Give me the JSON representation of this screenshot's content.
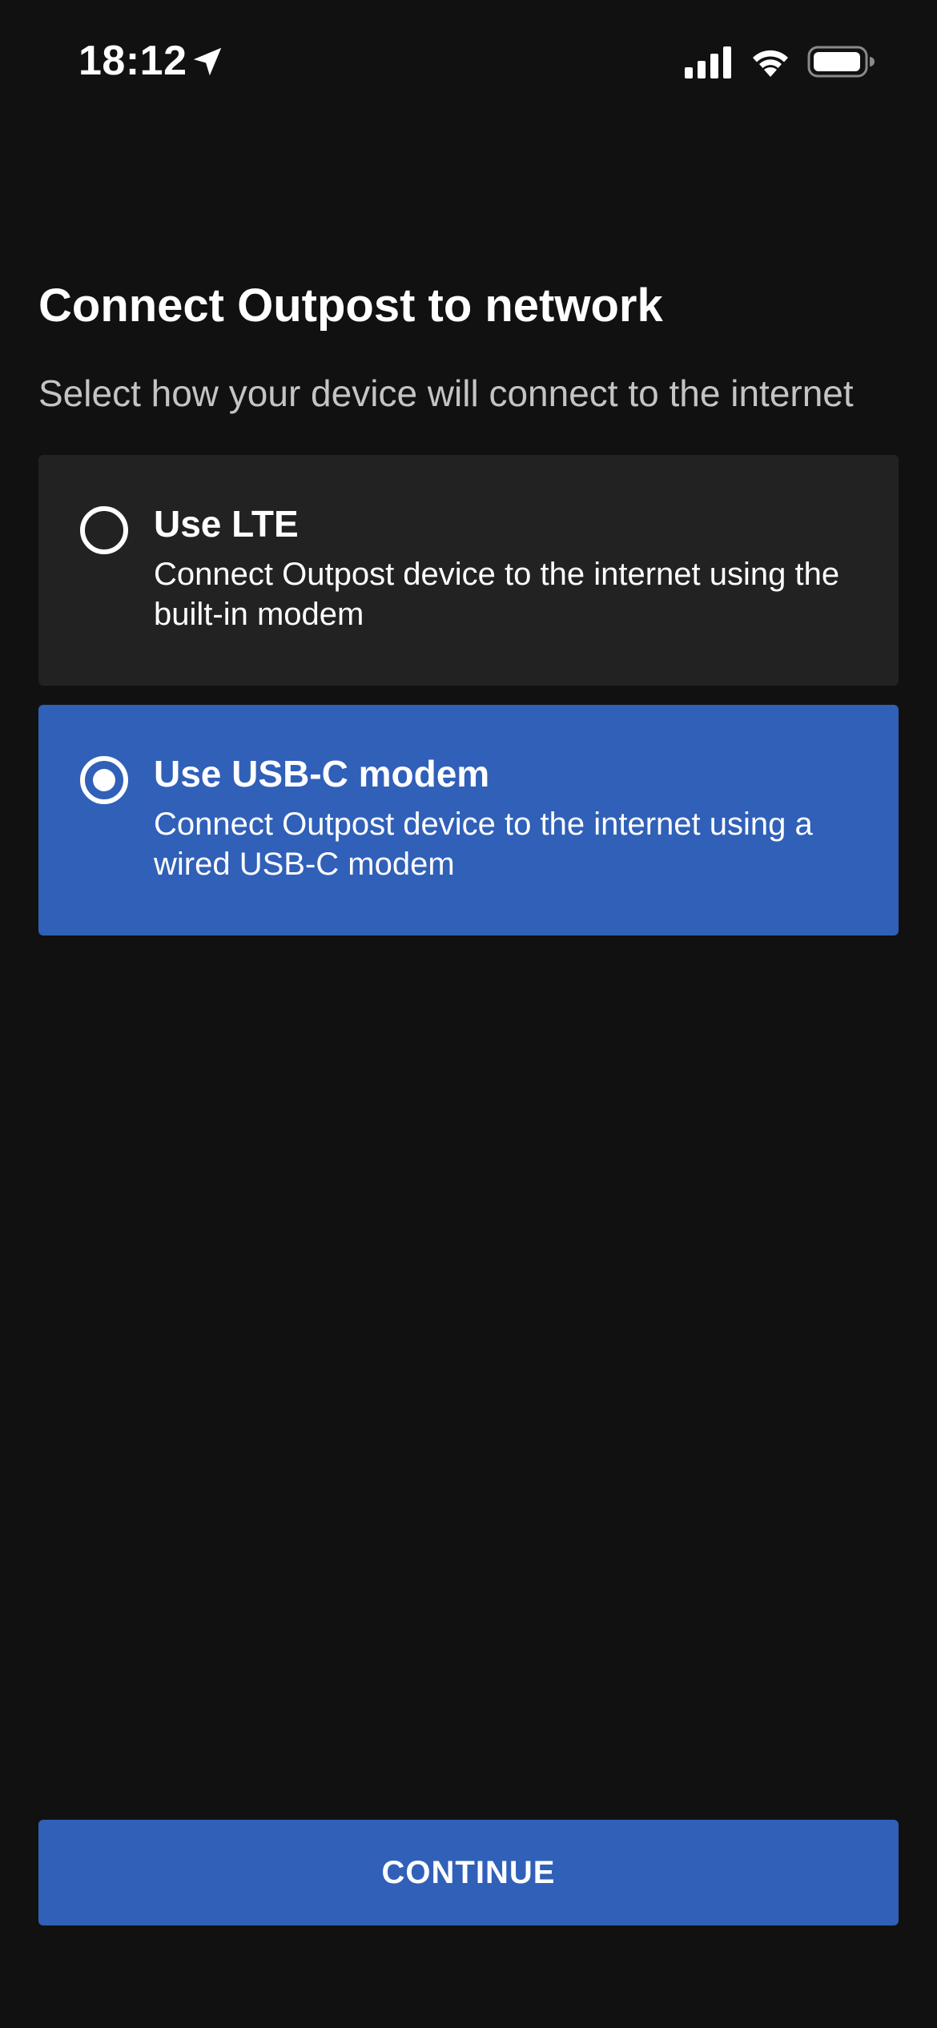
{
  "status_bar": {
    "time": "18:12",
    "icons": [
      "location-arrow-icon",
      "cellular-signal-icon",
      "wifi-icon",
      "battery-icon"
    ]
  },
  "page": {
    "title": "Connect Outpost to network",
    "subtitle": "Select how your device will connect to the internet"
  },
  "options": [
    {
      "title": "Use LTE",
      "description": "Connect Outpost device to the internet using the built-in modem",
      "selected": false
    },
    {
      "title": "Use USB-C modem",
      "description": "Connect Outpost device to the internet using a wired USB-C modem",
      "selected": true
    }
  ],
  "actions": {
    "continue_label": "CONTINUE"
  },
  "colors": {
    "background": "#111111",
    "card_unselected": "#222222",
    "accent": "#3060b8",
    "subtitle_text": "#c4c4c4"
  }
}
